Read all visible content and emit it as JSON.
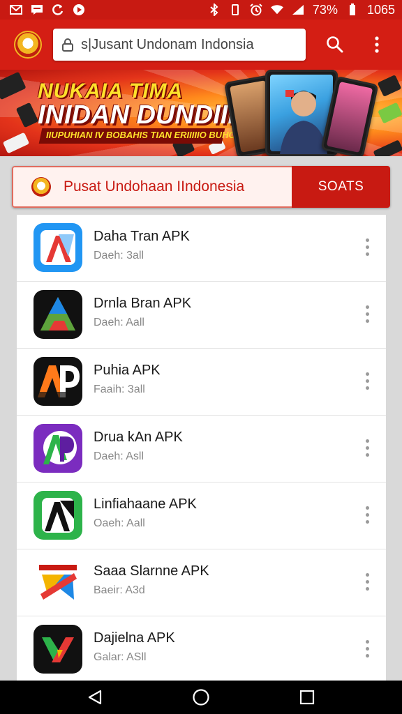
{
  "status_bar": {
    "left_icons": [
      "gmail-icon",
      "message-icon",
      "sync-icon",
      "record-icon"
    ],
    "right_icons": [
      "bluetooth-icon",
      "vibrate-icon",
      "alarm-icon",
      "wifi-icon",
      "signal-icon"
    ],
    "battery": "73%",
    "time": "1065"
  },
  "toolbar": {
    "url": "s|Jusant Undonam Indonsia",
    "search_icon": "search-icon",
    "menu_icon": "more-vert-icon"
  },
  "banner": {
    "line1": "NUKAIA TIMA",
    "line2": "INIDAN DUNDIIL",
    "line3": "IIUPUHIAN IV BOBAHIS TIAN ERIIIIIO BUHCAIN"
  },
  "site": {
    "title": "Pusat Undohaan IIndonesia",
    "button": "SOATS"
  },
  "apps": [
    {
      "name": "Daha Tran APK",
      "meta": "Daeh: 3all",
      "icon": "a-logo-icon",
      "colors": [
        "#1e88e5",
        "#e53935"
      ]
    },
    {
      "name": "Drnla Bran APK",
      "meta": "Daeh: Aall",
      "icon": "triangle-logo-icon",
      "colors": [
        "#111111",
        "#f4b400"
      ]
    },
    {
      "name": "Puhia APK",
      "meta": "Faaih: 3all",
      "icon": "ap-logo-icon",
      "colors": [
        "#111111",
        "#ff7a1a"
      ]
    },
    {
      "name": "Drua kAn APK",
      "meta": "Daeh: Asll",
      "icon": "ap-purple-logo-icon",
      "colors": [
        "#7b2cbf",
        "#2db34a"
      ]
    },
    {
      "name": "Linfiahaane APK",
      "meta": "Oaeh: Aall",
      "icon": "a-green-logo-icon",
      "colors": [
        "#2db34a",
        "#ffffff"
      ]
    },
    {
      "name": "Saaa Slarnne APK",
      "meta": "Baeir: A3d",
      "icon": "play-triangle-logo-icon",
      "colors": [
        "#e53935",
        "#1e88e5"
      ]
    },
    {
      "name": "Dajielna APK",
      "meta": "Galar: ASll",
      "icon": "x-logo-icon",
      "colors": [
        "#111111",
        "#e53935"
      ]
    }
  ],
  "nav": {
    "back_icon": "back-icon",
    "home_icon": "home-icon",
    "recents_icon": "recents-icon"
  }
}
